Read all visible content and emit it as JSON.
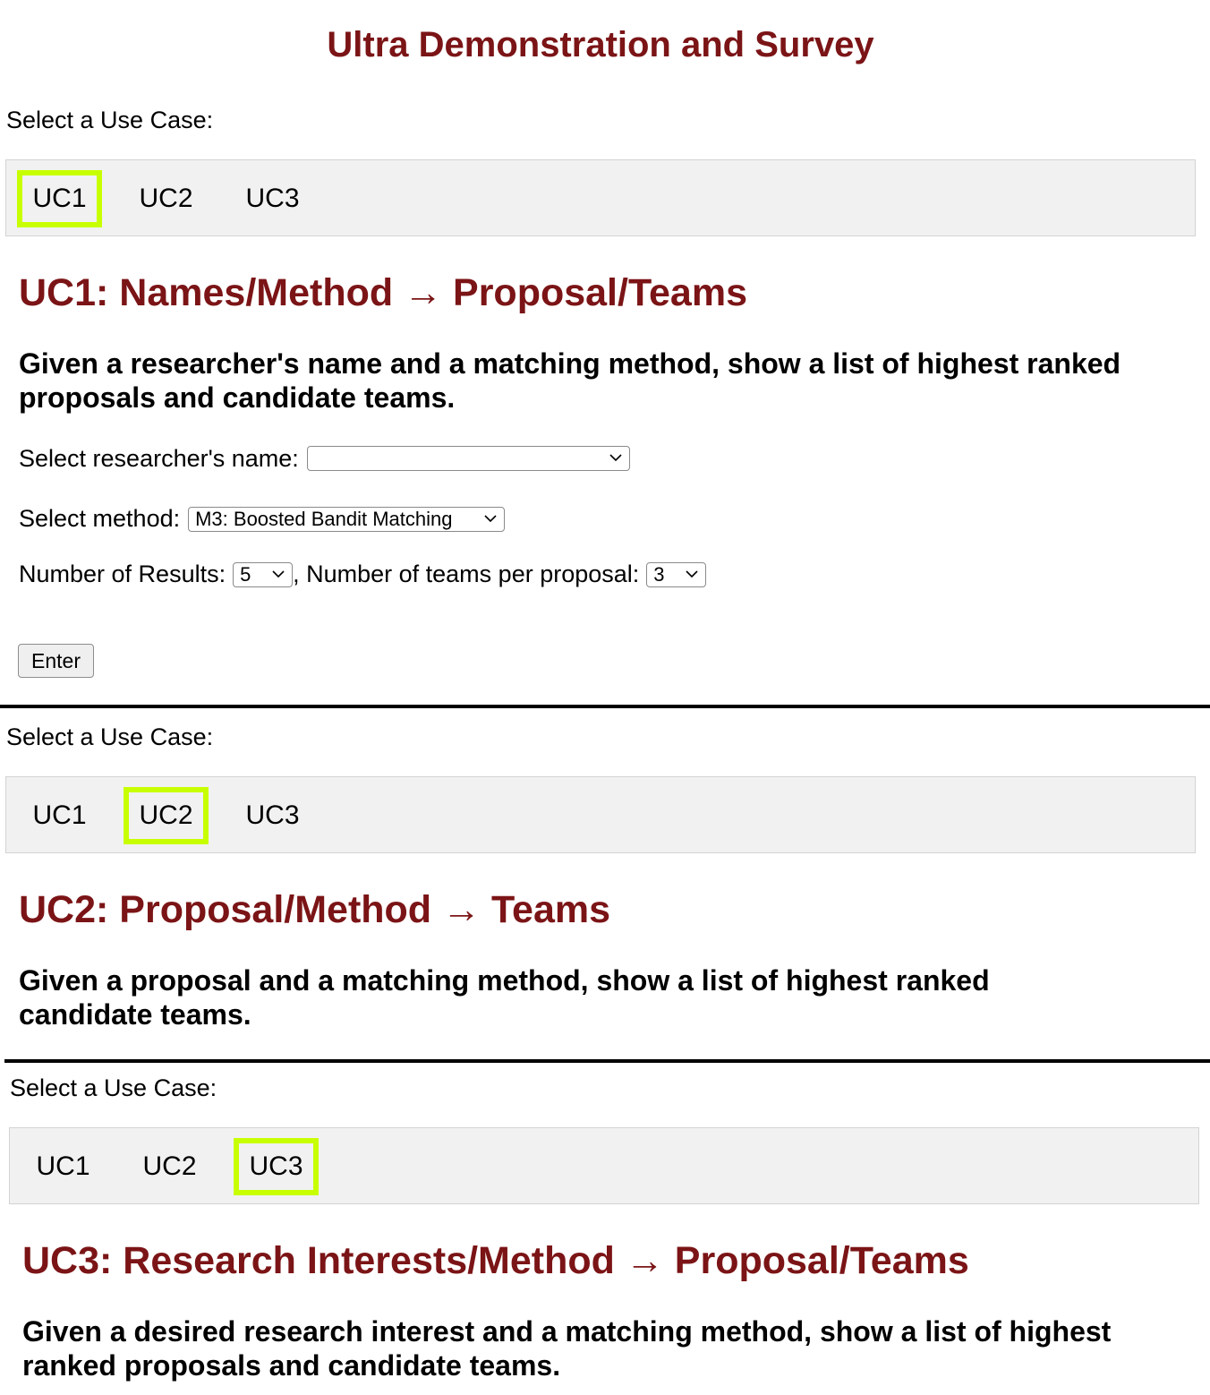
{
  "page_title": "Ultra Demonstration and Survey",
  "sections": [
    {
      "select_label": "Select a Use Case:",
      "tabs": [
        "UC1",
        "UC2",
        "UC3"
      ],
      "active_tab": "UC1",
      "heading": "UC1: Names/Method → Proposal/Teams",
      "description": "Given a researcher's name and a matching method, show a list of highest ranked proposals and candidate teams.",
      "form": {
        "researcher_label": "Select researcher's name:",
        "researcher_value": "",
        "method_label": "Select method:",
        "method_value": "M3: Boosted Bandit Matching",
        "results_label": "Number of Results:",
        "results_value": "5",
        "teams_label": ", Number of teams per proposal:",
        "teams_value": "3",
        "enter_label": "Enter"
      }
    },
    {
      "select_label": "Select a Use Case:",
      "tabs": [
        "UC1",
        "UC2",
        "UC3"
      ],
      "active_tab": "UC2",
      "heading": "UC2: Proposal/Method → Teams",
      "description": "Given a proposal and a matching method, show a list of highest ranked candidate teams."
    },
    {
      "select_label": "Select a Use Case:",
      "tabs": [
        "UC1",
        "UC2",
        "UC3"
      ],
      "active_tab": "UC3",
      "heading": "UC3: Research Interests/Method → Proposal/Teams",
      "description": "Given a desired research interest and a matching method, show a list of highest ranked proposals and candidate teams."
    }
  ],
  "colors": {
    "heading": "#7b1416",
    "tab_highlight": "#c8ff00",
    "tabbar_bg": "#f1f1f1"
  },
  "icons": {
    "dropdown": "chevron-down-icon"
  }
}
